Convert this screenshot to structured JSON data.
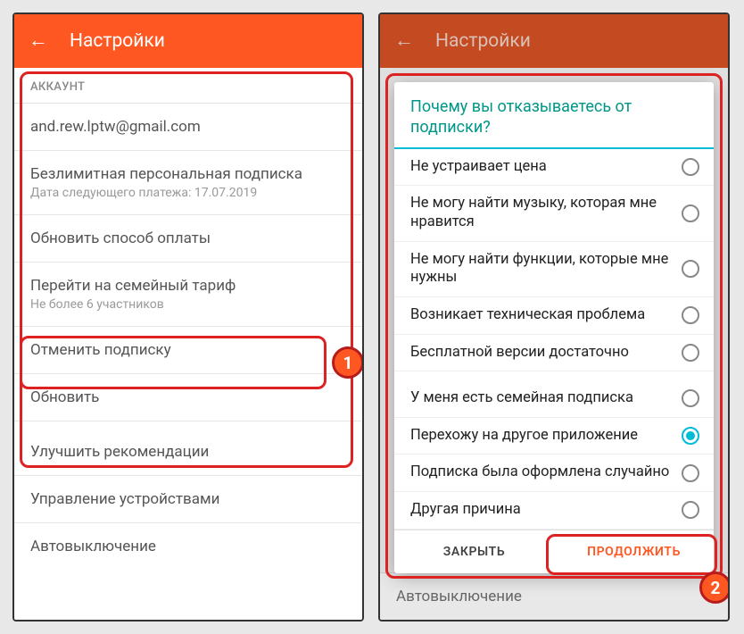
{
  "left": {
    "appbar_title": "Настройки",
    "section_account": "АККАУНТ",
    "rows": {
      "email": "and.rew.lptw@gmail.com",
      "sub_title": "Безлимитная персональная подписка",
      "sub_detail": "Дата следующего платежа: 17.07.2019",
      "payment": "Обновить способ оплаты",
      "family_title": "Перейти на семейный тариф",
      "family_detail": "Не более 6 участников",
      "cancel": "Отменить подписку",
      "refresh": "Обновить",
      "recommend": "Улучшить рекомендации",
      "devices": "Управление устройствами",
      "autoshutdown": "Автовыключение"
    }
  },
  "right": {
    "appbar_title": "Настройки",
    "bg_row": "Автовыключение",
    "dialog": {
      "title": "Почему вы отказываетесь от подписки?",
      "options": [
        "Не устраивает цена",
        "Не могу найти музыку, которая мне нравится",
        "Не могу найти функции, которые мне нужны",
        "Возникает техническая проблема",
        "Бесплатной версии достаточно",
        "У меня есть семейная подписка",
        "Перехожу на другое приложение",
        "Подписка была оформлена случайно",
        "Другая причина"
      ],
      "selected_index": 6,
      "close": "ЗАКРЫТЬ",
      "continue": "ПРОДОЛЖИТЬ"
    }
  },
  "badges": {
    "one": "1",
    "two": "2"
  }
}
